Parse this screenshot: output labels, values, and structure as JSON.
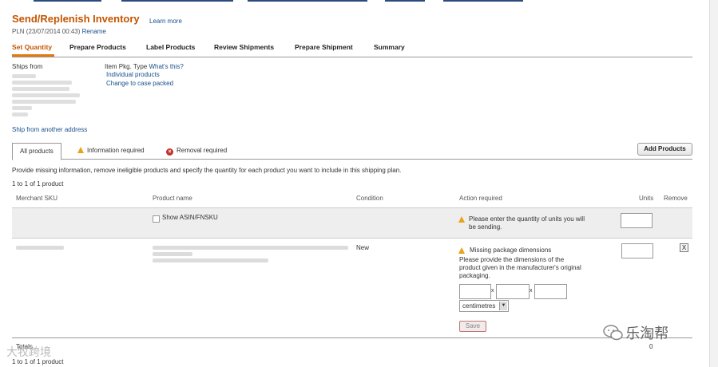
{
  "page": {
    "title": "Send/Replenish Inventory",
    "learn_more": "Learn more",
    "plan_name": "PLN (23/07/2014 00:43)",
    "rename": "Rename"
  },
  "steps": [
    {
      "label": "Set Quantity"
    },
    {
      "label": "Prepare Products"
    },
    {
      "label": "Label Products"
    },
    {
      "label": "Review Shipments"
    },
    {
      "label": "Prepare Shipment"
    },
    {
      "label": "Summary"
    }
  ],
  "ship_from": {
    "label": "Ships from",
    "ship_other": "Ship from another address"
  },
  "packing": {
    "label": "Item Pkg. Type",
    "whats_this": "What's this?",
    "option_individual": "Individual products",
    "option_case": "Change to case packed"
  },
  "filter_tabs": {
    "all": "All products",
    "info_required": "Information required",
    "removal_required": "Removal required"
  },
  "add_products": "Add Products",
  "instructions": "Provide missing information, remove ineligible products and specify the quantity for each product you want to include in this shipping plan.",
  "count_top": "1 to 1 of 1 product",
  "columns": {
    "sku": "Merchant SKU",
    "product": "Product name",
    "condition": "Condition",
    "action": "Action required",
    "units": "Units",
    "remove": "Remove"
  },
  "row_header": {
    "show_asin": "Show ASIN/FNSKU",
    "action_msg": "Please enter the quantity of units you will be sending."
  },
  "row_product": {
    "condition": "New",
    "missing_dims_title": "Missing package dimensions",
    "missing_dims_msg": "Please provide the dimensions of the product given in the manufacturer's original packaging.",
    "times": "x",
    "unit_select": "centimetres",
    "save": "Save",
    "remove_symbol": "X"
  },
  "totals": {
    "label": "Totals",
    "value": "0"
  },
  "count_bottom": "1 to 1 of 1 product",
  "watermark": {
    "left": "大牧跨境",
    "right": "乐淘帮"
  },
  "colors": {
    "accent": "#c45500",
    "tab_underline": "#e47911",
    "link": "#1a4f8b",
    "warning": "#e8a317",
    "error": "#c4302b"
  }
}
